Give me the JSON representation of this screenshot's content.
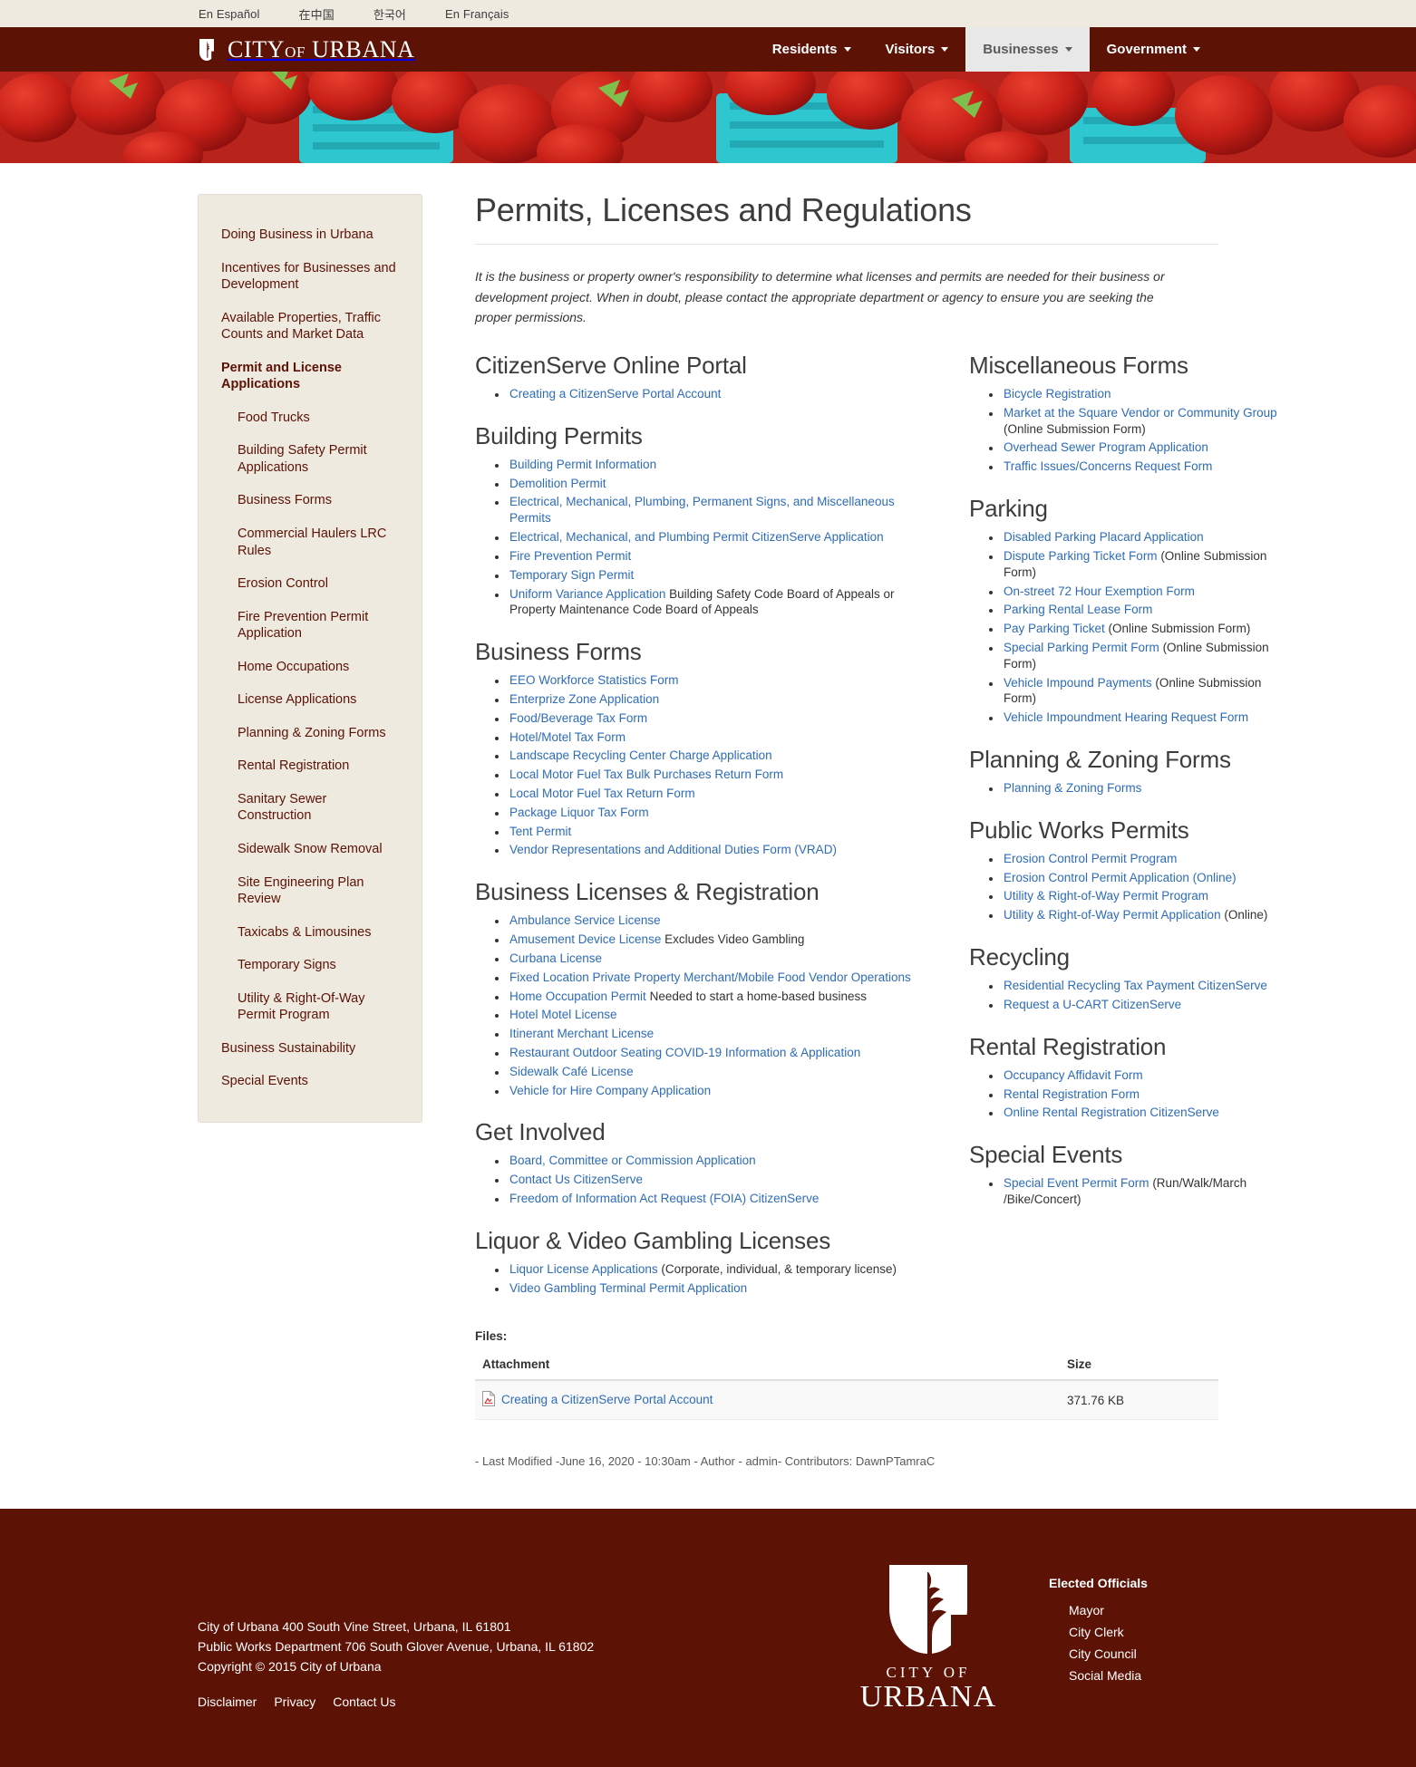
{
  "lang_bar": {
    "items": [
      {
        "label": "En Español"
      },
      {
        "label": "在中国"
      },
      {
        "label": "한국어"
      },
      {
        "label": "En Français"
      }
    ]
  },
  "header": {
    "brand_city": "CITY",
    "brand_of": "OF",
    "brand_urbana": "URBANA",
    "nav": [
      {
        "label": "Residents",
        "active": false
      },
      {
        "label": "Visitors",
        "active": false
      },
      {
        "label": "Businesses",
        "active": true
      },
      {
        "label": "Government",
        "active": false
      }
    ]
  },
  "sidebar": {
    "items": [
      {
        "label": "Doing Business in Urbana",
        "level": 0,
        "bold": false
      },
      {
        "label": "Incentives for Businesses and Development",
        "level": 0,
        "bold": false
      },
      {
        "label": "Available Properties, Traffic Counts and Market Data",
        "level": 0,
        "bold": false
      },
      {
        "label": "Permit and License Applications",
        "level": 0,
        "bold": true
      },
      {
        "label": "Food Trucks",
        "level": 1,
        "bold": false
      },
      {
        "label": "Building Safety Permit Applications",
        "level": 1,
        "bold": false
      },
      {
        "label": "Business Forms",
        "level": 1,
        "bold": false
      },
      {
        "label": "Commercial Haulers LRC Rules",
        "level": 1,
        "bold": false
      },
      {
        "label": "Erosion Control",
        "level": 1,
        "bold": false
      },
      {
        "label": "Fire Prevention Permit Application",
        "level": 1,
        "bold": false
      },
      {
        "label": "Home Occupations",
        "level": 1,
        "bold": false
      },
      {
        "label": "License Applications",
        "level": 1,
        "bold": false
      },
      {
        "label": "Planning & Zoning Forms",
        "level": 1,
        "bold": false
      },
      {
        "label": "Rental Registration",
        "level": 1,
        "bold": false
      },
      {
        "label": "Sanitary Sewer Construction",
        "level": 1,
        "bold": false
      },
      {
        "label": "Sidewalk Snow Removal",
        "level": 1,
        "bold": false
      },
      {
        "label": "Site Engineering Plan Review",
        "level": 1,
        "bold": false
      },
      {
        "label": "Taxicabs & Limousines",
        "level": 1,
        "bold": false
      },
      {
        "label": "Temporary Signs",
        "level": 1,
        "bold": false
      },
      {
        "label": "Utility & Right-Of-Way Permit Program",
        "level": 1,
        "bold": false
      },
      {
        "label": "Business Sustainability",
        "level": 0,
        "bold": false
      },
      {
        "label": "Special Events",
        "level": 0,
        "bold": false
      }
    ]
  },
  "main": {
    "title": "Permits, Licenses and Regulations",
    "intro": "It is the business or property owner's responsibility to determine what licenses and permits are needed for their business or development project. When in doubt, please contact the appropriate department or agency to ensure you are seeking the proper permissions.",
    "left_sections": [
      {
        "heading": "CitizenServe Online Portal",
        "items": [
          {
            "link": "Creating a CitizenServe Portal Account",
            "text": ""
          }
        ]
      },
      {
        "heading": "Building Permits",
        "items": [
          {
            "link": "Building Permit Information",
            "text": ""
          },
          {
            "link": "Demolition Permit",
            "text": ""
          },
          {
            "link": "Electrical, Mechanical, Plumbing, Permanent Signs, and Miscellaneous Permits",
            "text": ""
          },
          {
            "link": "Electrical, Mechanical, and Plumbing Permit CitizenServe Application",
            "text": ""
          },
          {
            "link": "Fire Prevention Permit",
            "text": ""
          },
          {
            "link": "Temporary Sign Permit",
            "text": ""
          },
          {
            "link": "Uniform Variance Application",
            "text": " Building Safety Code Board of Appeals or Property Maintenance Code Board of Appeals"
          }
        ]
      },
      {
        "heading": "Business Forms",
        "items": [
          {
            "link": "EEO Workforce Statistics Form",
            "text": ""
          },
          {
            "link": "Enterprize Zone Application",
            "text": ""
          },
          {
            "link": "Food/Beverage Tax Form",
            "text": ""
          },
          {
            "link": "Hotel/Motel Tax Form",
            "text": ""
          },
          {
            "link": "Landscape Recycling Center Charge Application",
            "text": ""
          },
          {
            "link": "Local Motor Fuel Tax Bulk Purchases Return Form",
            "text": ""
          },
          {
            "link": "Local Motor Fuel Tax Return Form",
            "text": ""
          },
          {
            "link": "Package Liquor Tax Form",
            "text": ""
          },
          {
            "link": "Tent Permit",
            "text": ""
          },
          {
            "link": "Vendor Representations and Additional Duties Form (VRAD)",
            "text": ""
          }
        ]
      },
      {
        "heading": "Business Licenses & Registration",
        "items": [
          {
            "link": "Ambulance Service License",
            "text": ""
          },
          {
            "link": "Amusement Device License",
            "text": " Excludes Video Gambling"
          },
          {
            "link": "Curbana License",
            "text": ""
          },
          {
            "link": "Fixed Location Private Property Merchant/Mobile Food Vendor Operations",
            "text": ""
          },
          {
            "link": "Home Occupation Permit",
            "text": " Needed to start a home-based business"
          },
          {
            "link": "Hotel Motel License",
            "text": ""
          },
          {
            "link": "Itinerant Merchant License",
            "text": ""
          },
          {
            "link": "Restaurant Outdoor Seating COVID-19 Information & Application",
            "text": ""
          },
          {
            "link": "Sidewalk Café License",
            "text": ""
          },
          {
            "link": "Vehicle for Hire Company Application",
            "text": ""
          }
        ]
      },
      {
        "heading": "Get Involved",
        "items": [
          {
            "link": "Board, Committee or Commission Application",
            "text": ""
          },
          {
            "link": "Contact Us CitizenServe",
            "text": ""
          },
          {
            "link": "Freedom of Information Act Request (FOIA) CitizenServe",
            "text": ""
          }
        ]
      },
      {
        "heading": "Liquor & Video Gambling Licenses",
        "items": [
          {
            "link": "Liquor License Applications",
            "text": " (Corporate, individual, & temporary license)"
          },
          {
            "link": "Video Gambling Terminal Permit Application",
            "text": ""
          }
        ]
      }
    ],
    "right_sections": [
      {
        "heading": "Miscellaneous Forms",
        "items": [
          {
            "link": "Bicycle Registration",
            "text": ""
          },
          {
            "link": "Market at the Square Vendor or Community Group",
            "text": " (Online Submission Form)"
          },
          {
            "link": "Overhead Sewer Program Application",
            "text": ""
          },
          {
            "link": "Traffic Issues/Concerns Request Form",
            "text": ""
          }
        ]
      },
      {
        "heading": "Parking",
        "items": [
          {
            "link": "Disabled Parking Placard Application",
            "text": ""
          },
          {
            "link": "Dispute Parking Ticket Form",
            "text": " (Online Submission Form)"
          },
          {
            "link": "On-street 72 Hour Exemption Form",
            "text": ""
          },
          {
            "link": "Parking Rental Lease Form",
            "text": ""
          },
          {
            "link": "Pay Parking Ticket",
            "text": " (Online Submission Form)"
          },
          {
            "link": "Special Parking Permit Form",
            "text": " (Online Submission Form)"
          },
          {
            "link": "Vehicle Impound Payments",
            "text": " (Online Submission Form)"
          },
          {
            "link": "Vehicle Impoundment Hearing Request Form",
            "text": ""
          }
        ]
      },
      {
        "heading": "Planning & Zoning Forms",
        "items": [
          {
            "link": "Planning & Zoning Forms",
            "text": ""
          }
        ]
      },
      {
        "heading": "Public Works Permits",
        "items": [
          {
            "link": "Erosion Control Permit Program",
            "text": ""
          },
          {
            "link": "Erosion Control Permit Application (Online)",
            "text": ""
          },
          {
            "link": "Utility & Right-of-Way Permit Program",
            "text": ""
          },
          {
            "link": "Utility & Right-of-Way Permit Application",
            "text": " (Online)"
          }
        ]
      },
      {
        "heading": "Recycling",
        "items": [
          {
            "link": "Residential Recycling Tax Payment CitizenServe",
            "text": ""
          },
          {
            "link": "Request a U-CART CitizenServe",
            "text": ""
          }
        ]
      },
      {
        "heading": "Rental Registration",
        "items": [
          {
            "link": "Occupancy Affidavit Form",
            "text": ""
          },
          {
            "link": "Rental Registration Form",
            "text": ""
          },
          {
            "link": "Online Rental Registration CitizenServe",
            "text": ""
          }
        ]
      },
      {
        "heading": "Special Events",
        "items": [
          {
            "link": "Special Event Permit Form",
            "text": " (Run/Walk/March /Bike/Concert)"
          }
        ]
      }
    ],
    "files": {
      "label": "Files:",
      "col_attachment": "Attachment",
      "col_size": "Size",
      "rows": [
        {
          "name": "Creating a CitizenServe Portal Account",
          "size": "371.76 KB",
          "icon": "pdf-icon"
        }
      ]
    },
    "modified": "- Last Modified -June 16, 2020 - 10:30am - Author - admin- Contributors: DawnPTamraC"
  },
  "footer": {
    "address_line1": "City of Urbana 400 South Vine Street, Urbana, IL 61801",
    "address_line2": "Public Works Department 706 South Glover Avenue, Urbana, IL 61802",
    "copyright": "Copyright © 2015 City of Urbana",
    "links": [
      {
        "label": "Disclaimer"
      },
      {
        "label": "Privacy"
      },
      {
        "label": "Contact Us"
      }
    ],
    "logo_city_of": "CITY OF",
    "logo_urbana": "URBANA",
    "officials_title": "Elected Officials",
    "officials": [
      {
        "label": "Mayor"
      },
      {
        "label": "City Clerk"
      },
      {
        "label": "City Council"
      },
      {
        "label": "Social Media"
      }
    ]
  },
  "colors": {
    "brand_maroon": "#5c1205",
    "link_blue": "#2e6cb8",
    "sidebar_bg": "#eeeae0",
    "lang_bar_bg": "#eeeae0"
  }
}
